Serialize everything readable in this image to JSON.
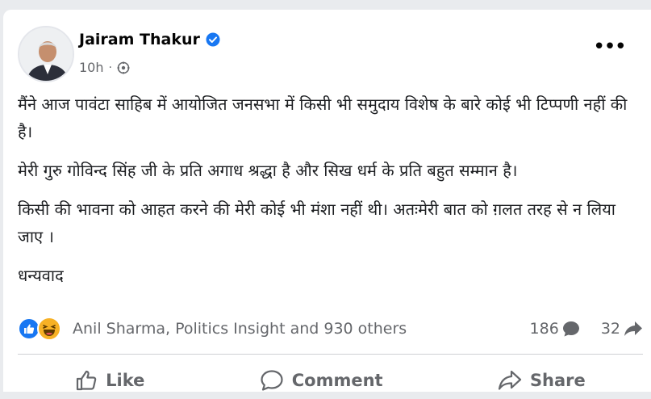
{
  "post": {
    "author": "Jairam Thakur",
    "time": "10h",
    "separator": "·",
    "paragraphs": [
      "मैंने आज पावंटा साहिब में आयोजित जनसभा में किसी भी समुदाय विशेष के बारे कोई भी टिप्पणी नहीं की है।",
      "मेरी गुरु गोविन्द सिंह जी के प्रति अगाध श्रद्धा है और सिख धर्म के प्रति बहुत सम्मान है।",
      "किसी की भावना को आहत करने की मेरी कोई भी मंशा नहीं थी। अतःमेरी बात को ग़लत तरह से न लिया जाए ।",
      "धन्यवाद"
    ]
  },
  "reactions": {
    "names": "Anil Sharma, Politics Insight and 930 others",
    "comments": "186",
    "shares": "32",
    "icons": [
      "like-reaction-icon",
      "haha-reaction-icon"
    ]
  },
  "actions": {
    "like": "Like",
    "comment": "Comment",
    "share": "Share"
  },
  "colors": {
    "brand_blue": "#1877f2",
    "secondary_text": "#65676b",
    "haha_yellow": "#f7b125"
  }
}
